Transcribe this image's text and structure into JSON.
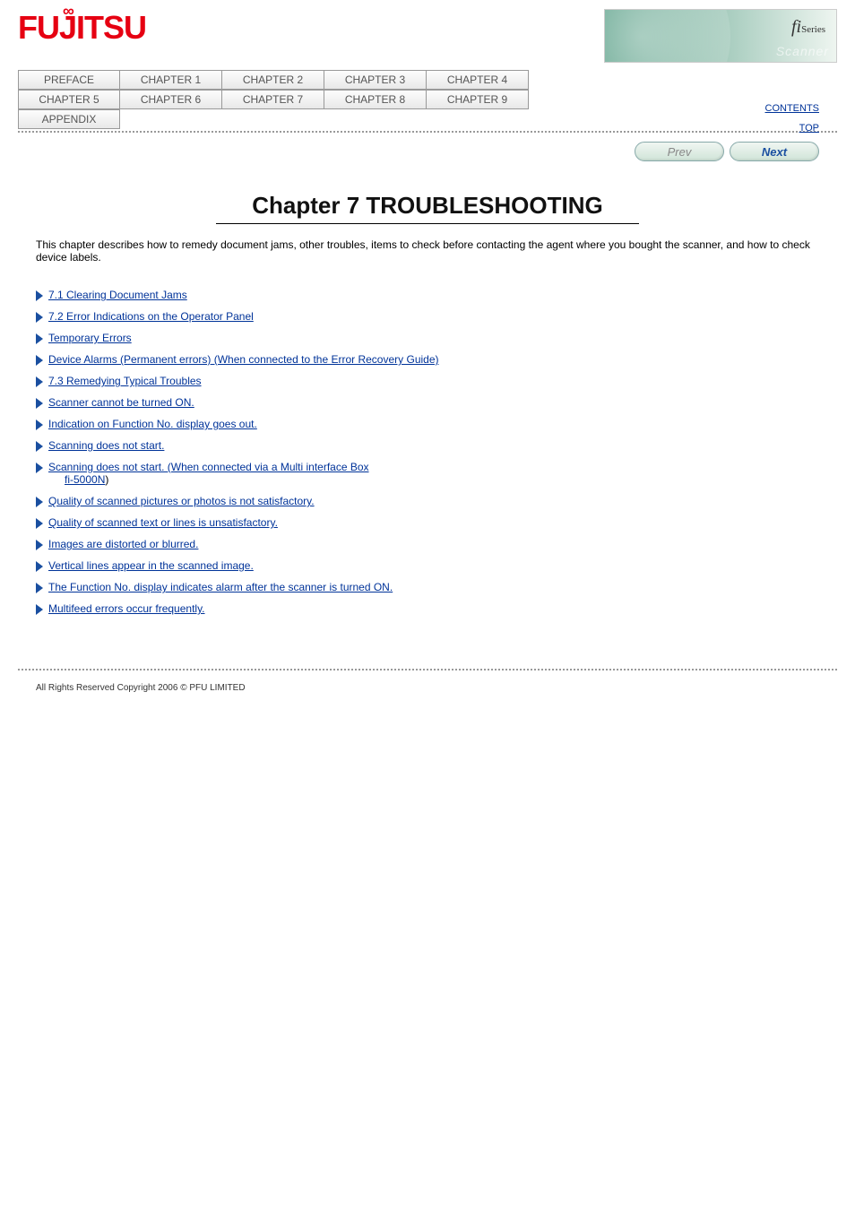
{
  "logo_text": "FUJITSU",
  "banner": {
    "fi": "fi",
    "series": "Series",
    "scanner": "Scanner"
  },
  "tabs_row1": [
    "PREFACE",
    "CHAPTER 1",
    "CHAPTER 2",
    "CHAPTER 3",
    "CHAPTER 4"
  ],
  "tabs_row2": [
    "CHAPTER 5",
    "CHAPTER 6",
    "CHAPTER 7",
    "CHAPTER 8",
    "CHAPTER 9"
  ],
  "tabs_row3": [
    "APPENDIX"
  ],
  "top_links": {
    "contents": "CONTENTS",
    "top": "TOP"
  },
  "prev_label": "Prev",
  "next_label": "Next",
  "chapter": {
    "title": "Chapter 7 TROUBLESHOOTING",
    "intro": "This chapter describes how to remedy document jams, other troubles, items to check before contacting the agent where you bought the scanner, and how to check device labels."
  },
  "links": [
    {
      "text": "7.1 Clearing Document Jams"
    },
    {
      "text": "7.2 Error Indications on the Operator Panel"
    },
    {
      "text": "Temporary Errors"
    },
    {
      "text": "Device Alarms (Permanent errors) (When connected to the Error Recovery Guide)"
    },
    {
      "text": "7.3 Remedying Typical Troubles"
    },
    {
      "text": "Scanner cannot be turned ON."
    },
    {
      "text": "Indication on Function No. display goes out."
    },
    {
      "text": "Scanning does not start."
    },
    {
      "text_prefix": "Scanning does not start. (When connected via a Multi interface Box ",
      "anchor_text": "fi-5000N",
      "text_suffix": ")"
    },
    {
      "text": "Quality of scanned pictures or photos is not satisfactory."
    },
    {
      "text": "Quality of scanned text or lines is unsatisfactory."
    },
    {
      "text": "Images are distorted or blurred."
    },
    {
      "text": "Vertical lines appear in the scanned image."
    },
    {
      "text": "The Function No. display indicates alarm after the scanner is turned ON."
    },
    {
      "text": "Multifeed errors occur frequently."
    }
  ],
  "footer": "All Rights Reserved Copyright 2006 © PFU LIMITED"
}
